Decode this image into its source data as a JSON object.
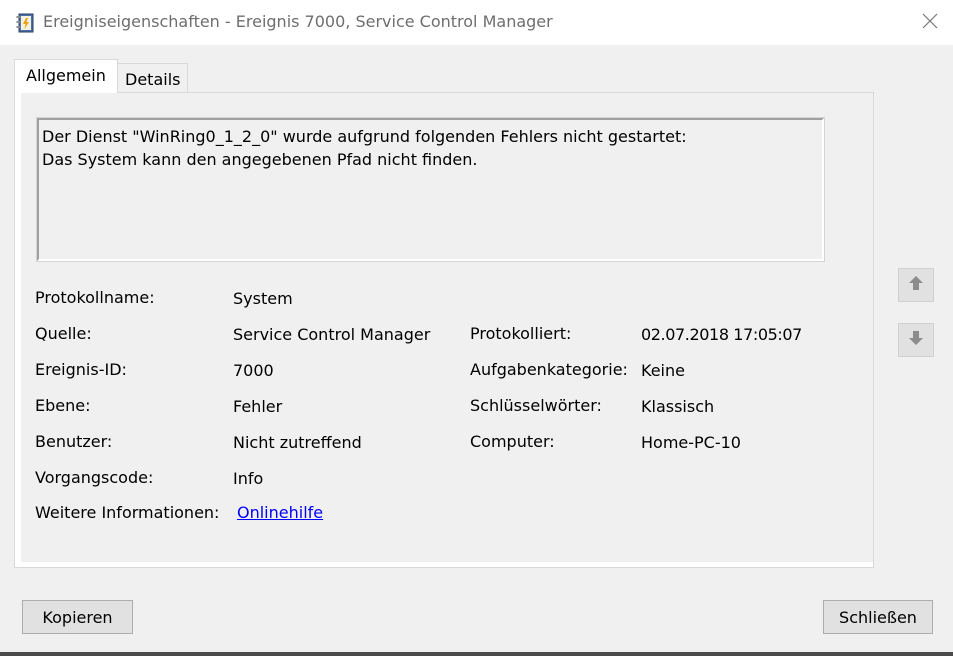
{
  "window": {
    "title": "Ereigniseigenschaften - Ereignis 7000, Service Control Manager"
  },
  "tabs": [
    {
      "label": "Allgemein"
    },
    {
      "label": "Details"
    }
  ],
  "description": "Der Dienst \"WinRing0_1_2_0\" wurde aufgrund folgenden Fehlers nicht gestartet:\nDas System kann den angegebenen Pfad nicht finden.",
  "fields": {
    "log_name_label": "Protokollname:",
    "log_name_value": "System",
    "source_label": "Quelle:",
    "source_value": "Service Control Manager",
    "logged_label": "Protokolliert:",
    "logged_value": "02.07.2018 17:05:07",
    "event_id_label": "Ereignis-ID:",
    "event_id_value": "7000",
    "task_category_label": "Aufgabenkategorie:",
    "task_category_value": "Keine",
    "level_label": "Ebene:",
    "level_value": "Fehler",
    "keywords_label": "Schlüsselwörter:",
    "keywords_value": "Klassisch",
    "user_label": "Benutzer:",
    "user_value": "Nicht zutreffend",
    "computer_label": "Computer:",
    "computer_value": "Home-PC-10",
    "opcode_label": "Vorgangscode:",
    "opcode_value": "Info",
    "more_info_label": "Weitere Informationen:",
    "more_info_link": "Onlinehilfe"
  },
  "buttons": {
    "copy": "Kopieren",
    "close": "Schließen"
  },
  "icons": {
    "app": "event-properties-icon",
    "close": "close-icon",
    "up": "arrow-up-icon",
    "down": "arrow-down-icon"
  },
  "colors": {
    "link": "#0000ff",
    "title_text": "#6e6e6e"
  }
}
